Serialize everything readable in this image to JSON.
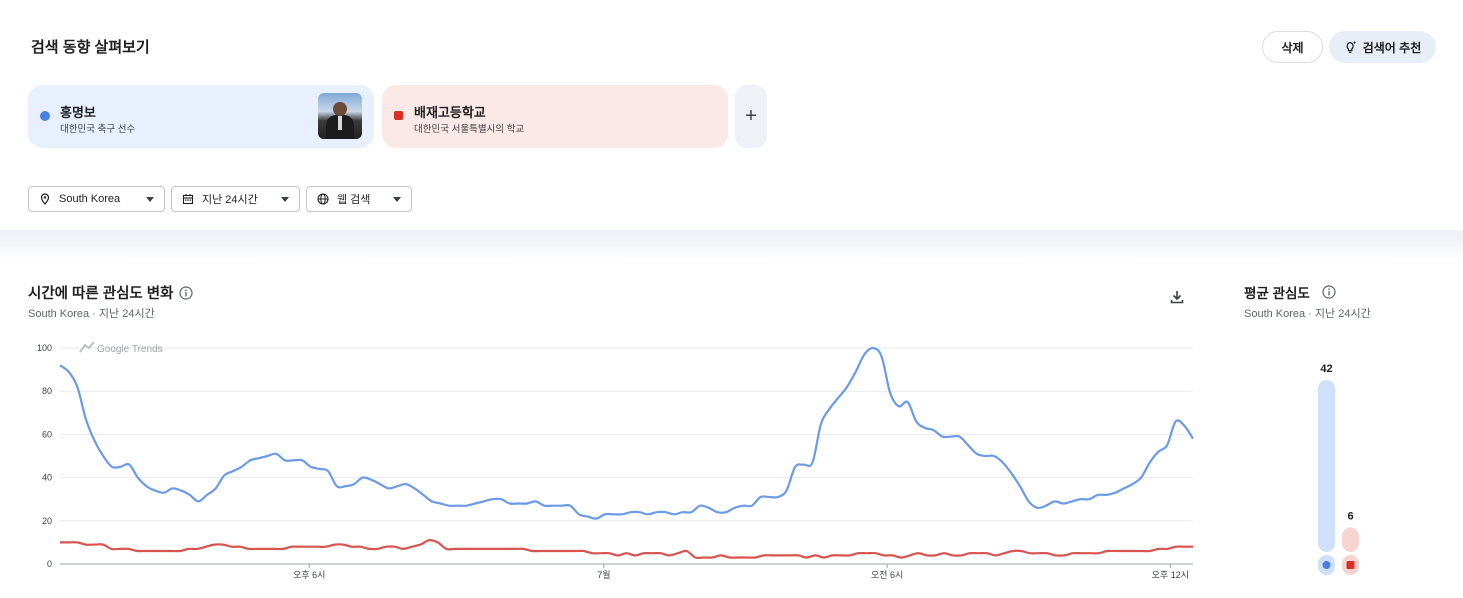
{
  "header": {
    "title": "검색 동향 살펴보기",
    "delete_label": "삭제",
    "suggest_label": "검색어 추천"
  },
  "terms": [
    {
      "name": "홍명보",
      "description": "대한민국 축구 선수",
      "color": "#4a7fe6"
    },
    {
      "name": "배재고등학교",
      "description": "대한민국 서울특별시의 학교",
      "color": "#d93025"
    }
  ],
  "add_term_label": "+",
  "filters": {
    "region": "South Korea",
    "time": "지난 24시간",
    "category": "웹 검색"
  },
  "interest_over_time": {
    "title": "시간에 따른 관심도 변화",
    "subtitle": "South Korea · 지난 24시간",
    "watermark": "Google Trends"
  },
  "average_interest": {
    "title": "평균 관심도",
    "subtitle": "South Korea · 지난 24시간",
    "values": [
      42,
      6
    ]
  },
  "chart_data": {
    "type": "line",
    "ylim": [
      0,
      100
    ],
    "yticks": [
      0,
      20,
      40,
      60,
      80,
      100
    ],
    "xtick_labels": [
      "오후 6시",
      "7월",
      "오전 6시",
      "오후 12시"
    ],
    "xtick_positions": [
      22,
      48,
      73,
      98
    ],
    "grid": true,
    "series": [
      {
        "name": "홍명보",
        "color": "#6b9ae8",
        "values": [
          92,
          89,
          82,
          67,
          57,
          50,
          45,
          45,
          46,
          40,
          36,
          34,
          33,
          35,
          34,
          32,
          29,
          32,
          35,
          41,
          43,
          45,
          48,
          49,
          50,
          51,
          48,
          48,
          48,
          45,
          44,
          43,
          36,
          36,
          37,
          40,
          39,
          37,
          35,
          36,
          37,
          35,
          32,
          29,
          28,
          27,
          27,
          27,
          28,
          29,
          30,
          30,
          28,
          28,
          28,
          29,
          27,
          27,
          27,
          27,
          23,
          22,
          21,
          23,
          23,
          23,
          24,
          24,
          23,
          24,
          24,
          23,
          24,
          24,
          27,
          26,
          24,
          24,
          26,
          27,
          27,
          31,
          31,
          31,
          34,
          45,
          46,
          47,
          65,
          72,
          77,
          82,
          89,
          97,
          100,
          96,
          79,
          73,
          75,
          66,
          63,
          62,
          59,
          59,
          59,
          55,
          51,
          50,
          50,
          47,
          42,
          36,
          29,
          26,
          27,
          29,
          28,
          29,
          30,
          30,
          32,
          32,
          33,
          35,
          37,
          40,
          47,
          52,
          55,
          66,
          64,
          58
        ]
      },
      {
        "name": "배재고등학교",
        "color": "#d9534f",
        "values": [
          10,
          10,
          10,
          9,
          9,
          9,
          7,
          7,
          7,
          6,
          6,
          6,
          6,
          6,
          6,
          7,
          7,
          8,
          9,
          9,
          8,
          8,
          7,
          7,
          7,
          7,
          7,
          8,
          8,
          8,
          8,
          8,
          9,
          9,
          8,
          8,
          7,
          7,
          8,
          8,
          7,
          8,
          9,
          11,
          10,
          7,
          7,
          7,
          7,
          7,
          7,
          7,
          7,
          7,
          7,
          6,
          6,
          6,
          6,
          6,
          6,
          6,
          5,
          5,
          5,
          4,
          5,
          4,
          5,
          5,
          5,
          4,
          5,
          6,
          3,
          3,
          3,
          4,
          3,
          3,
          3,
          3,
          4,
          4,
          4,
          4,
          4,
          3,
          4,
          3,
          4,
          4,
          4,
          5,
          5,
          5,
          4,
          4,
          3,
          4,
          5,
          4,
          4,
          5,
          4,
          4,
          5,
          5,
          5,
          4,
          5,
          6,
          6,
          5,
          5,
          5,
          4,
          4,
          5,
          5,
          5,
          5,
          6,
          6,
          6,
          6,
          6,
          6,
          7,
          7,
          8,
          8,
          8
        ]
      }
    ]
  }
}
